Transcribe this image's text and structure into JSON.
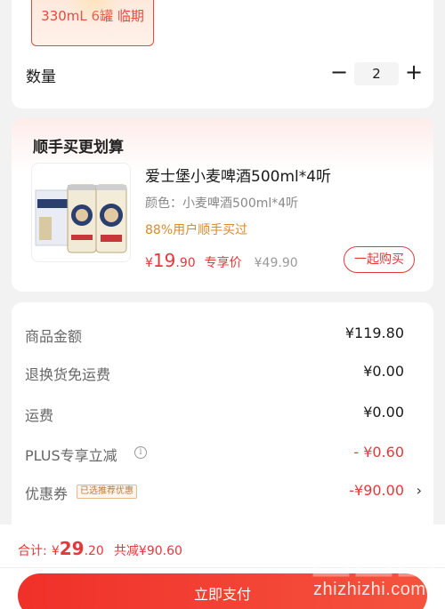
{
  "variant": {
    "label": "330mL 6罐 临期"
  },
  "quantity": {
    "label": "数量",
    "minus": "−",
    "value": "2",
    "plus": "+"
  },
  "bundle": {
    "title": "顺手买更划算",
    "product": {
      "name": "爱士堡小麦啤酒500ml*4听",
      "spec": "颜色：小麦啤酒500ml*4听",
      "social": "88%用户顺手买过",
      "price_yen": "¥",
      "price_int": "19",
      "price_dec": ".90",
      "price_tag": "专享价",
      "orig_price": "¥49.90",
      "action": "一起购买"
    }
  },
  "summary": {
    "goods": {
      "label": "商品金额",
      "value": "¥119.80"
    },
    "return_shipping": {
      "label": "退换货免运费",
      "value": "¥0.00"
    },
    "shipping": {
      "label": "运费",
      "value": "¥0.00"
    },
    "plus": {
      "label": "PLUS专享立减",
      "info": "i",
      "value": "- ¥0.60"
    },
    "coupon": {
      "label": "优惠券",
      "badge": "已选推荐优惠",
      "value": "-¥90.00",
      "chevron": "›"
    }
  },
  "footer": {
    "total_label": "合计:",
    "total_yen": "¥",
    "total_int": "29",
    "total_dec": ".20",
    "saving": "共减¥90.60",
    "pay": "立即支付"
  },
  "watermark": {
    "text": "zhizhizhi.com"
  },
  "colors": {
    "accent": "#e4393c",
    "social": "#d98a2a",
    "badge": "#b7793e"
  }
}
